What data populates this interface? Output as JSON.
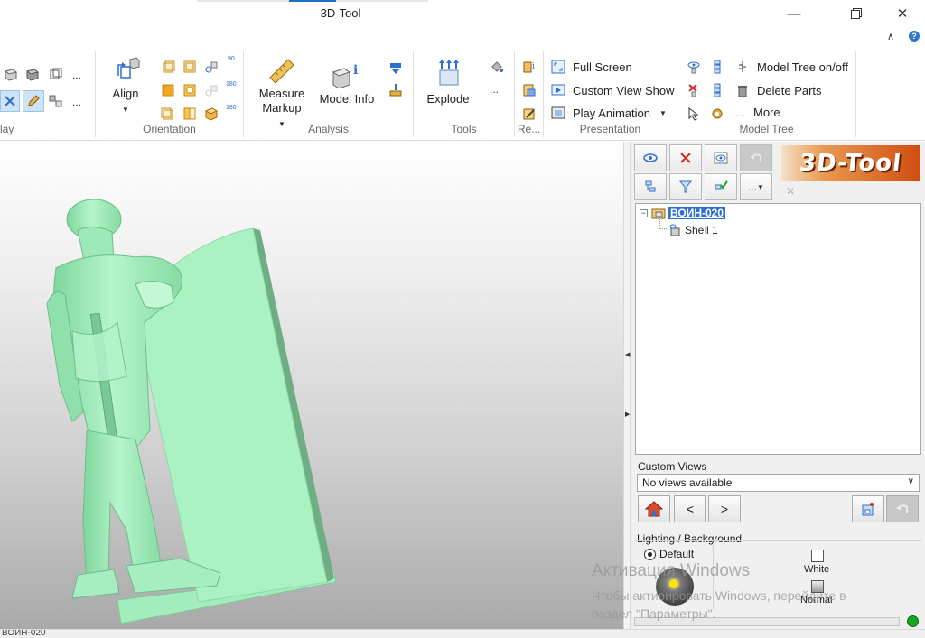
{
  "window": {
    "title": "3D-Tool"
  },
  "ribbon": {
    "groups": {
      "display": "lay",
      "orientation": "Orientation",
      "analysis": "Analysis",
      "tools": "Tools",
      "reports": "Re...",
      "presentation": "Presentation",
      "model_tree": "Model Tree"
    },
    "buttons": {
      "align": "Align",
      "measure_line1": "Measure",
      "measure_line2": "Markup",
      "model_info": "Model Info",
      "explode": "Explode",
      "full_screen": "Full Screen",
      "custom_view_show": "Custom View Show",
      "play_animation": "Play Animation",
      "model_tree_onoff": "Model Tree on/off",
      "delete_parts": "Delete Parts",
      "more": "More",
      "ellipsis": "...",
      "angle_90": "90",
      "angle_180a": "180",
      "angle_180b": "180"
    }
  },
  "panel": {
    "logo_text": "3D-Tool",
    "tree": {
      "root": "ВОИН-020",
      "child": "Shell 1"
    },
    "custom_views": {
      "label": "Custom Views",
      "selected": "No views available",
      "prev": "<",
      "next": ">"
    },
    "lighting": {
      "label": "Lighting / Background",
      "default_label": "Default",
      "white_label": "White",
      "normal_label": "Normal"
    }
  },
  "watermark": {
    "line1": "Активация Windows",
    "line2": "Чтобы активировать Windows, перейдите в раздел \"Параметры\"."
  },
  "statusbar": {
    "text": "ВОИН-020"
  },
  "colors": {
    "model": "#a8efc0",
    "accent": "#2f6fd0",
    "logo": "#d04c12",
    "status_ok": "#1aa51e"
  }
}
